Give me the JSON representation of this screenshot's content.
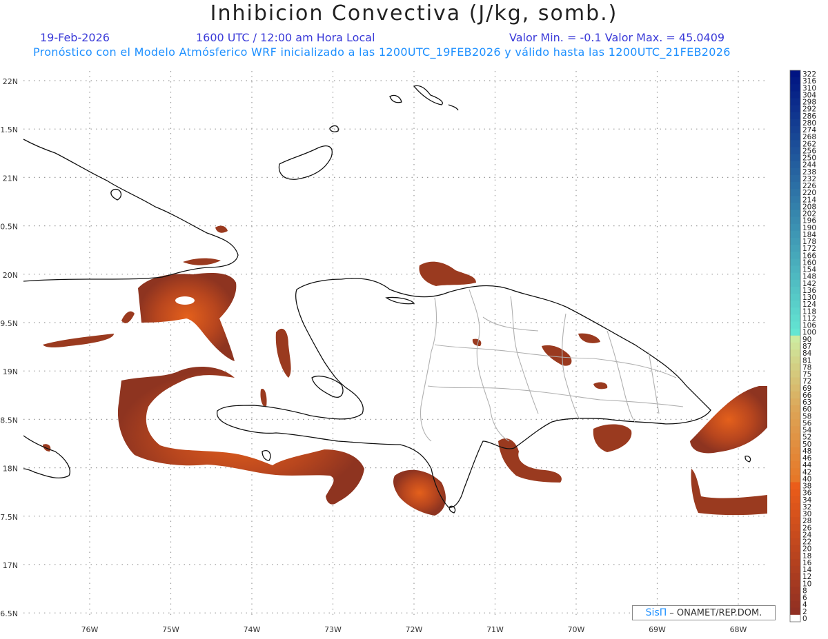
{
  "header": {
    "title": "Inhibicion Convectiva (J/kg, somb.)",
    "date": "19-Feb-2026",
    "time": "1600 UTC / 12:00 am Hora Local",
    "minmax": "Valor Min. = -0.1  Valor Max. = 45.0409",
    "description": "Pronóstico con el Modelo Atmósferico WRF inicializado a las 1200UTC_19FEB2026 y válido hasta las  1200UTC_21FEB2026"
  },
  "axes": {
    "lat_labels": [
      "22N",
      "1.5N",
      "21N",
      "0.5N",
      "20N",
      "9.5N",
      "19N",
      "8.5N",
      "18N",
      "7.5N",
      "17N",
      "6.5N"
    ],
    "lon_labels": [
      "76W",
      "75W",
      "74W",
      "73W",
      "72W",
      "71W",
      "70W",
      "69W",
      "68W"
    ]
  },
  "colorbar": {
    "labels": [
      "322",
      "316",
      "310",
      "304",
      "298",
      "292",
      "286",
      "280",
      "274",
      "268",
      "262",
      "256",
      "250",
      "244",
      "238",
      "232",
      "226",
      "220",
      "214",
      "208",
      "202",
      "196",
      "190",
      "184",
      "178",
      "172",
      "166",
      "160",
      "154",
      "148",
      "142",
      "136",
      "130",
      "124",
      "118",
      "112",
      "106",
      "100",
      "90",
      "87",
      "84",
      "81",
      "78",
      "75",
      "72",
      "69",
      "66",
      "63",
      "60",
      "58",
      "56",
      "54",
      "52",
      "50",
      "48",
      "46",
      "44",
      "42",
      "40",
      "38",
      "36",
      "34",
      "32",
      "30",
      "28",
      "26",
      "24",
      "22",
      "20",
      "18",
      "16",
      "14",
      "12",
      "10",
      "8",
      "6",
      "4",
      "2",
      "0"
    ]
  },
  "credit": {
    "brand": "SisΠ",
    "text": "– ONAMET/REP.DOM."
  },
  "colors": {
    "fill_dark": "#8e3420",
    "fill_mid": "#b8461e",
    "fill_hot": "#e0591c",
    "coast": "#111111",
    "province": "#b0b0b0"
  }
}
